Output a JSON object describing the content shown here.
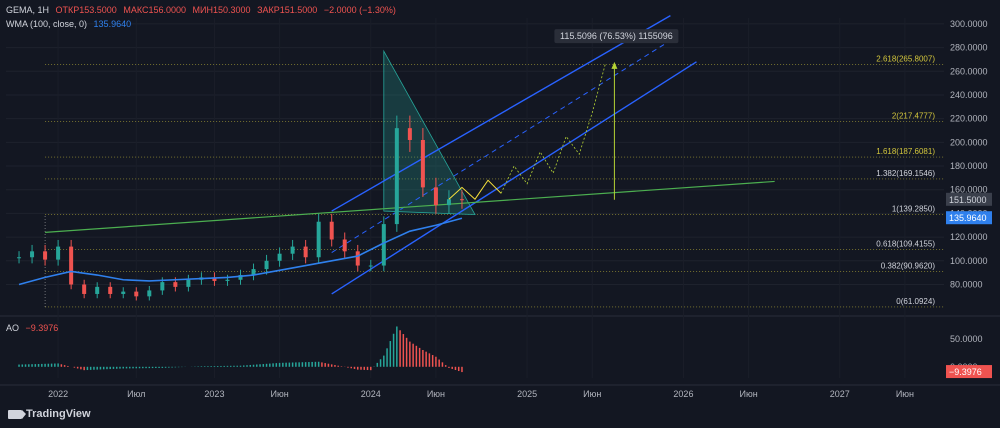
{
  "header": {
    "symbol": "GEMA, 1H",
    "open": "ОТКР153.5000",
    "high": "МАКС156.0000",
    "low": "МИН150.3000",
    "close": "ЗАКР151.5000",
    "change": "−2.0000 (−1.30%)",
    "wma_label": "WMA (100, close, 0)",
    "wma_value": "135.9640",
    "ao_label": "AO",
    "ao_value": "−9.3976"
  },
  "branding": {
    "name": "TradingView"
  },
  "colors": {
    "background": "#131722",
    "up": "#26a69a",
    "down": "#ef5350",
    "wma": "#2f80ed",
    "channel": "#2962ff",
    "trendline": "#4caf50",
    "fib": "#d4c73c",
    "triangle": "#26a69a",
    "projection": "#b5d334"
  },
  "chart_data": {
    "type": "line",
    "title": "GEMA, 1H",
    "y_axis": {
      "ticks": [
        "300.0000",
        "280.0000",
        "260.0000",
        "240.0000",
        "220.0000",
        "200.0000",
        "180.0000",
        "160.0000",
        "140.0000",
        "120.0000",
        "100.0000",
        "80.0000"
      ],
      "range": [
        61,
        305
      ]
    },
    "x_axis": {
      "ticks": [
        "2022",
        "Июл",
        "2023",
        "Июн",
        "2024",
        "Июн",
        "2025",
        "Июн",
        "2026",
        "Июн",
        "2027",
        "Июн"
      ],
      "range": [
        "2021-09",
        "2027-09"
      ]
    },
    "price_labels": {
      "last": "151.5000",
      "wma": "135.9640"
    },
    "fib_levels": [
      {
        "label": "0(61.0924)",
        "value": 61.09
      },
      {
        "label": "0.382(90.9620)",
        "value": 90.96
      },
      {
        "label": "0.618(109.4155)",
        "value": 109.42
      },
      {
        "label": "1(139.2850)",
        "value": 139.29
      },
      {
        "label": "1.382(169.1546)",
        "value": 169.15
      },
      {
        "label": "1.618(187.6081)",
        "value": 187.61
      },
      {
        "label": "2(217.4777)",
        "value": 217.48
      },
      {
        "label": "2.618(265.8007)",
        "value": 265.8
      }
    ],
    "measure_label": "115.5096 (76.53%) 1155096",
    "series": [
      {
        "name": "GEMA",
        "x": [
          "2021-10",
          "2021-11",
          "2021-12",
          "2022-01",
          "2022-02",
          "2022-03",
          "2022-04",
          "2022-05",
          "2022-06",
          "2022-07",
          "2022-08",
          "2022-09",
          "2022-10",
          "2022-11",
          "2022-12",
          "2023-01",
          "2023-02",
          "2023-03",
          "2023-04",
          "2023-05",
          "2023-06",
          "2023-07",
          "2023-08",
          "2023-09",
          "2023-10",
          "2023-11",
          "2023-12",
          "2024-01",
          "2024-02",
          "2024-03",
          "2024-04",
          "2024-05",
          "2024-06",
          "2024-07",
          "2024-08"
        ],
        "values": [
          103,
          108,
          101,
          112,
          80,
          72,
          78,
          72,
          74,
          70,
          75,
          82,
          78,
          84,
          86,
          83,
          84,
          88,
          93,
          100,
          106,
          112,
          103,
          133,
          118,
          108,
          96,
          96,
          131,
          212,
          202,
          162,
          147,
          152,
          151.5
        ]
      },
      {
        "name": "WMA (100, close, 0)",
        "x": [
          "2021-10",
          "2021-12",
          "2022-02",
          "2022-04",
          "2022-06",
          "2022-08",
          "2022-10",
          "2022-12",
          "2023-02",
          "2023-04",
          "2023-06",
          "2023-08",
          "2023-10",
          "2023-12",
          "2024-02",
          "2024-04",
          "2024-06",
          "2024-08"
        ],
        "values": [
          80,
          86,
          91,
          88,
          84,
          83,
          84,
          85,
          86,
          88,
          92,
          96,
          100,
          104,
          115,
          125,
          130,
          135.96
        ]
      },
      {
        "name": "AO",
        "x": [
          "2021-10",
          "2022-01",
          "2022-03",
          "2022-06",
          "2022-09",
          "2022-12",
          "2023-03",
          "2023-06",
          "2023-09",
          "2023-12",
          "2024-01",
          "2024-02",
          "2024-03",
          "2024-04",
          "2024-05",
          "2024-06",
          "2024-07",
          "2024-08"
        ],
        "values": [
          4,
          6,
          -6,
          -3,
          -2,
          1,
          2,
          7,
          9,
          -5,
          -6,
          20,
          72,
          45,
          30,
          18,
          -2,
          -9.4
        ]
      }
    ],
    "ao_axis": {
      "ticks": [
        "50.0000",
        "0.0000"
      ],
      "last": "−9.3976"
    }
  }
}
